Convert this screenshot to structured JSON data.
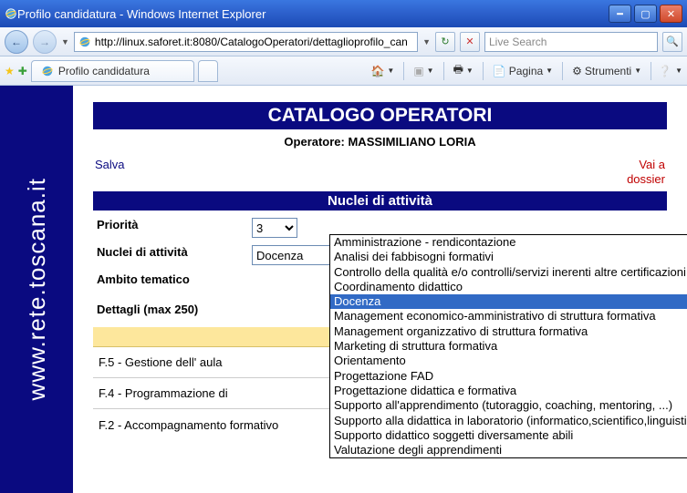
{
  "window": {
    "title": "Profilo candidatura - Windows Internet Explorer"
  },
  "navbar": {
    "url": "http://linux.saforet.it:8080/CatalogoOperatori/dettaglioprofilo_can",
    "search_placeholder": "Live Search"
  },
  "tab": {
    "label": "Profilo candidatura"
  },
  "menubar": {
    "page": "Pagina",
    "tools": "Strumenti"
  },
  "sidebar": {
    "text": "www.rete.toscana.it"
  },
  "page": {
    "title": "CATALOGO OPERATORI",
    "subtitle": "Operatore: MASSIMILIANO LORIA",
    "save": "Salva",
    "dossier": "Vai a dossier",
    "section": "Nuclei di attività"
  },
  "form": {
    "priority_label": "Priorità",
    "priority_value": "3",
    "nuclei_label": "Nuclei di attività",
    "nuclei_value": "Docenza",
    "ambito_label": "Ambito tematico",
    "dettagli_label": "Dettagli (max 250)"
  },
  "dropdown": {
    "options": [
      "Amministrazione - rendicontazione",
      "Analisi dei fabbisogni formativi",
      "Controllo della qualità e/o controlli/servizi inerenti altre certificazioni",
      "Coordinamento didattico",
      "Docenza",
      "Management economico-amministrativo di struttura formativa",
      "Management organizzativo di struttura formativa",
      "Marketing di struttura formativa",
      "Orientamento",
      "Progettazione FAD",
      "Progettazione didattica e formativa",
      "Supporto all'apprendimento (tutoraggio, coaching, mentoring, ...)",
      "Supporto alla didattica in laboratorio (informatico,scientifico,linguistico)",
      "Supporto didattico soggetti diversamente abili",
      "Valutazione degli apprendimenti"
    ],
    "selected_index": 4
  },
  "list": {
    "items": [
      "F.5 - Gestione dell' aula",
      "F.4 - Programmazione di",
      "F.2 - Accompagnamento formativo"
    ]
  }
}
